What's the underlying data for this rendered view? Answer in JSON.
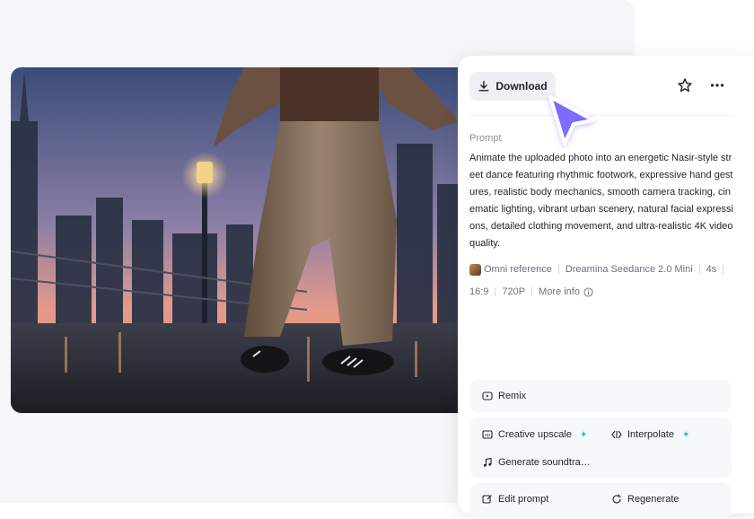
{
  "toolbar": {
    "download_label": "Download"
  },
  "prompt": {
    "label": "Prompt",
    "text": "Animate the uploaded photo into an energetic Nasir-style street dance featuring rhythmic footwork, expressive hand gestures, realistic body mechanics, smooth camera tracking, cinematic lighting, vibrant urban scenery, natural facial expressions, detailed clothing movement, and ultra-realistic 4K video quality."
  },
  "meta": {
    "reference": "Omni reference",
    "model": "Dreamina Seedance 2.0 Mini",
    "duration": "4s",
    "ratio": "16:9",
    "resolution": "720P",
    "more_info": "More info"
  },
  "actions": {
    "remix": "Remix",
    "creative_upscale": "Creative upscale",
    "interpolate": "Interpolate",
    "generate_soundtrack": "Generate soundtra…",
    "edit_prompt": "Edit prompt",
    "regenerate": "Regenerate"
  },
  "colors": {
    "accent_cursor": "#6c63ff",
    "sparkle": "#1ec0b5",
    "page_bg": "#f5f6f8"
  },
  "icons": {
    "download": "download-icon",
    "star": "star-icon",
    "more": "more-dots-icon",
    "info": "info-icon",
    "remix": "remix-icon",
    "upscale": "upscale-icon",
    "interpolate": "interpolate-icon",
    "soundtrack": "music-note-icon",
    "edit": "edit-icon",
    "regenerate": "regenerate-icon"
  }
}
